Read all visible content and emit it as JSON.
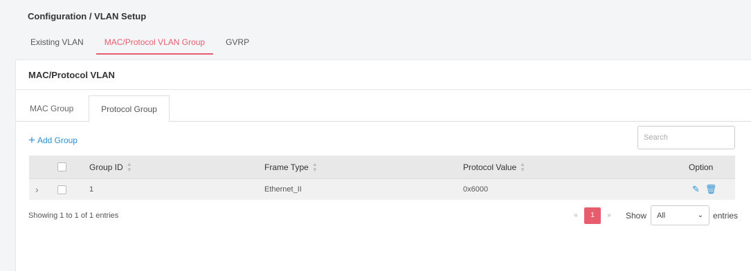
{
  "breadcrumb": "Configuration / VLAN Setup",
  "top_tabs": [
    {
      "label": "Existing VLAN",
      "active": false
    },
    {
      "label": "MAC/Protocol VLAN Group",
      "active": true
    },
    {
      "label": "GVRP",
      "active": false
    }
  ],
  "panel": {
    "title": "MAC/Protocol VLAN",
    "sub_tabs": [
      {
        "label": "MAC Group",
        "active": false
      },
      {
        "label": "Protocol Group",
        "active": true
      }
    ],
    "add_group_label": "Add Group",
    "search_placeholder": "Search"
  },
  "table": {
    "columns": [
      "Group ID",
      "Frame Type",
      "Protocol Value",
      "Option"
    ],
    "rows": [
      {
        "group_id": "1",
        "frame_type": "Ethernet_II",
        "protocol_value": "0x6000"
      }
    ]
  },
  "footer": {
    "info": "Showing 1 to 1 of 1 entries",
    "pager": {
      "prev": "«",
      "current": "1",
      "next": "»"
    },
    "show_label": "Show",
    "entries_value": "All",
    "entries_label": "entries"
  },
  "colors": {
    "accent": "#e85d6e",
    "link": "#2a8fd6"
  },
  "icons": {
    "add": "plus-icon",
    "edit": "pencil-icon",
    "delete": "trash-icon",
    "expand": "chevron-right-icon"
  }
}
